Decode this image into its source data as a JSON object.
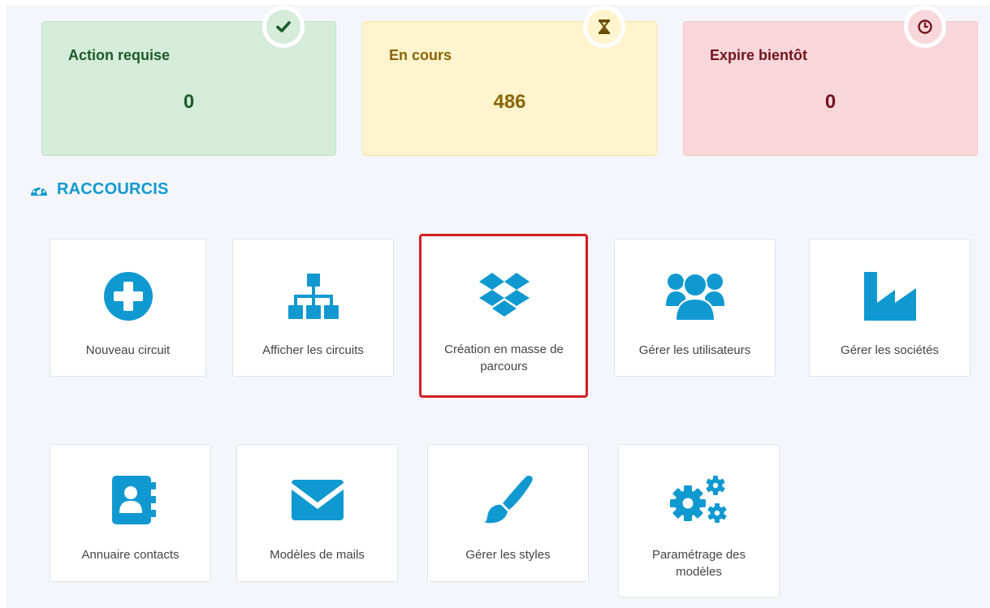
{
  "stats": [
    {
      "label": "Action requise",
      "count": "0",
      "icon": "check-icon"
    },
    {
      "label": "En cours",
      "count": "486",
      "icon": "hourglass-icon"
    },
    {
      "label": "Expire bientôt",
      "count": "0",
      "icon": "clock-icon"
    }
  ],
  "section": {
    "title": "RACCOURCIS",
    "icon": "dashboard-icon"
  },
  "shortcuts": [
    {
      "label": "Nouveau circuit",
      "icon": "plus-circle-icon"
    },
    {
      "label": "Afficher les circuits",
      "icon": "sitemap-icon"
    },
    {
      "label": "Création en masse de parcours",
      "icon": "dropbox-icon",
      "highlighted": true
    },
    {
      "label": "Gérer les utilisateurs",
      "icon": "users-icon"
    },
    {
      "label": "Gérer les sociétés",
      "icon": "industry-icon"
    },
    {
      "label": "Annuaire contacts",
      "icon": "address-book-icon"
    },
    {
      "label": "Modèles de mails",
      "icon": "envelope-icon"
    },
    {
      "label": "Gérer les styles",
      "icon": "paint-brush-icon"
    },
    {
      "label": "Paramétrage des modèles",
      "icon": "cogs-icon"
    }
  ],
  "colors": {
    "accent": "#1099d0",
    "success_bg": "#d4ecd9",
    "warning_bg": "#fff4cd",
    "danger_bg": "#f8d7db",
    "highlight": "#d31f26"
  }
}
